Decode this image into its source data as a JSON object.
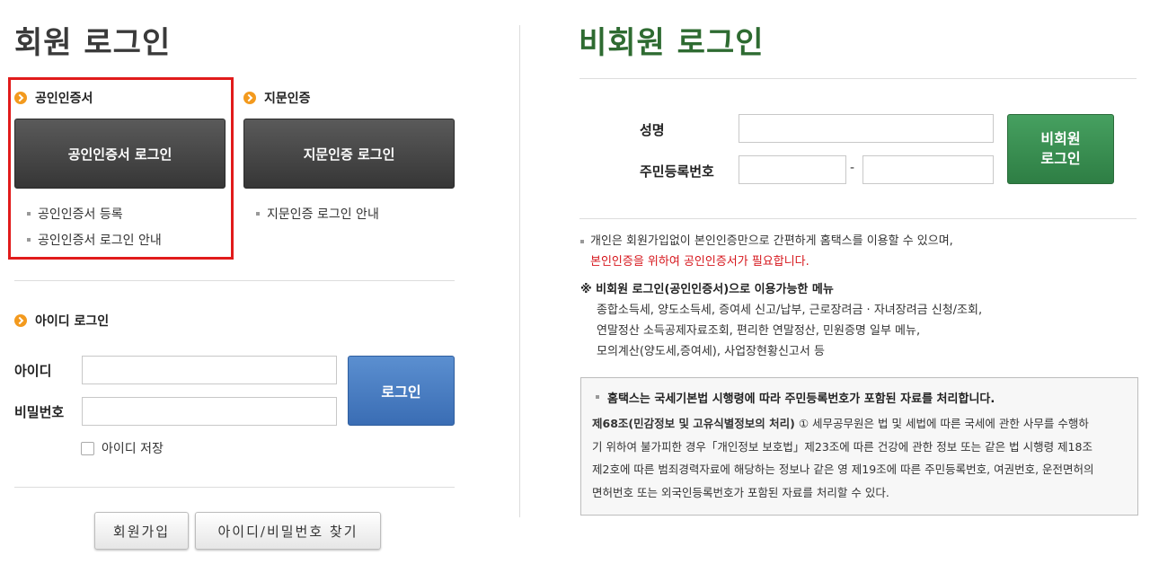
{
  "member": {
    "title": "회원 로그인",
    "cert": {
      "heading": "공인인증서",
      "button": "공인인증서 로그인",
      "links": [
        "공인인증서 등록",
        "공인인증서 로그인 안내"
      ]
    },
    "fingerprint": {
      "heading": "지문인증",
      "button": "지문인증 로그인",
      "links": [
        "지문인증 로그인 안내"
      ]
    },
    "id_login": {
      "heading": "아이디 로그인",
      "id_label": "아이디",
      "id_value": "",
      "pw_label": "비밀번호",
      "pw_value": "",
      "login_button": "로그인",
      "save_id": "아이디 저장"
    },
    "signup_button": "회원가입",
    "find_button": "아이디/비밀번호 찾기"
  },
  "nonmember": {
    "title": "비회원 로그인",
    "name_label": "성명",
    "name_value": "",
    "rrn_label": "주민등록번호",
    "rrn_first": "",
    "rrn_sep": "-",
    "rrn_second": "",
    "login_button_line1": "비회원",
    "login_button_line2": "로그인",
    "info_line1": "개인은 회원가입없이 본인인증만으로 간편하게 홈택스를 이용할 수 있으며,",
    "info_line2": "본인인증을 위하여 공인인증서가 필요합니다.",
    "menu_heading": "※ 비회원 로그인(공인인증서)으로 이용가능한 메뉴",
    "menu_lines": [
      "종합소득세, 양도소득세, 증여세 신고/납부, 근로장려금 · 자녀장려금 신청/조회,",
      "연말정산 소득공제자료조회, 편리한 연말정산, 민원증명 일부 메뉴,",
      "모의계산(양도세,증여세), 사업장현황신고서 등"
    ],
    "notice": {
      "heading": "홈택스는 국세기본법 시행령에 따라 주민등록번호가 포함된 자료를 처리합니다.",
      "body_bold": "제68조(민감정보 및 고유식별정보의 처리)",
      "body_lines": [
        " ① 세무공무원은 법 및 세법에 따른 국세에 관한 사무를 수행하",
        "기 위하여 불가피한 경우「개인정보 보호법」제23조에 따른 건강에 관한 정보 또는 같은 법 시행령 제18조",
        "제2호에 따른 범죄경력자료에 해당하는 정보나 같은 영 제19조에 따른 주민등록번호, 여권번호, 운전면허의",
        "면허번호 또는 외국인등록번호가 포함된 자료를 처리할 수 있다."
      ]
    }
  },
  "colors": {
    "member_title": "#3a3a3a",
    "nonmember_title": "#2e6b31",
    "highlight_border": "#e11b1b",
    "orange_bullet": "#f39a1e",
    "blue_button": "#3a6db4",
    "green_button": "#2e7e44",
    "red_text": "#d6161c"
  }
}
